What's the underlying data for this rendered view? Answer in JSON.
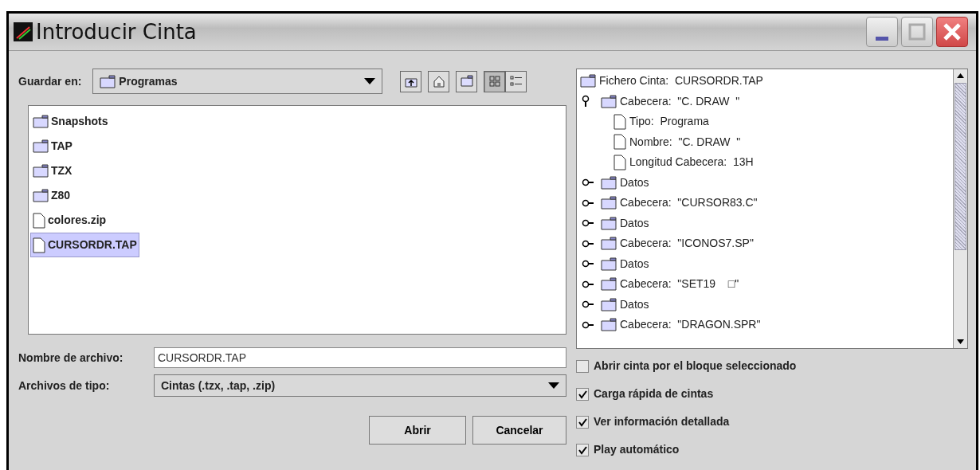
{
  "window": {
    "title": "Introducir Cinta"
  },
  "save_in": {
    "label": "Guardar en:",
    "value": "Programas"
  },
  "toolbar": [
    {
      "kind": "up-folder",
      "selected": false
    },
    {
      "kind": "home",
      "selected": false
    },
    {
      "kind": "new-folder",
      "selected": false
    },
    {
      "kind": "list-view",
      "selected": true
    },
    {
      "kind": "details-view",
      "selected": false
    }
  ],
  "files": [
    {
      "name": "Snapshots",
      "kind": "folder",
      "selected": false
    },
    {
      "name": "TAP",
      "kind": "folder",
      "selected": false
    },
    {
      "name": "TZX",
      "kind": "folder",
      "selected": false
    },
    {
      "name": "Z80",
      "kind": "folder",
      "selected": false
    },
    {
      "name": "colores.zip",
      "kind": "file",
      "selected": false
    },
    {
      "name": "CURSORDR.TAP",
      "kind": "file",
      "selected": true
    }
  ],
  "file_name": {
    "label": "Nombre de archivo:",
    "value": "CURSORDR.TAP"
  },
  "file_type": {
    "label": "Archivos de tipo:",
    "value": "Cintas (.tzx, .tap, .zip)"
  },
  "buttons": [
    {
      "label": "Abrir"
    },
    {
      "label": "Cancelar"
    }
  ],
  "tree": {
    "label": "Fichero Cinta:  CURSORDR.TAP",
    "kind": "folder",
    "children": [
      {
        "label": "Cabecera:  \"C. DRAW  \"",
        "kind": "folder",
        "expanded": true,
        "children": [
          {
            "label": "Tipo:  Programa",
            "kind": "file"
          },
          {
            "label": "Nombre:  \"C. DRAW  \"",
            "kind": "file"
          },
          {
            "label": "Longitud Cabecera:  13H",
            "kind": "file"
          }
        ]
      },
      {
        "label": "Datos",
        "kind": "folder",
        "expanded": false
      },
      {
        "label": "Cabecera:  \"CURSOR83.C\"",
        "kind": "folder",
        "expanded": false
      },
      {
        "label": "Datos",
        "kind": "folder",
        "expanded": false
      },
      {
        "label": "Cabecera:  \"ICONOS7.SP\"",
        "kind": "folder",
        "expanded": false
      },
      {
        "label": "Datos",
        "kind": "folder",
        "expanded": false
      },
      {
        "label": "Cabecera:  \"SET19    □\"",
        "kind": "folder",
        "expanded": false
      },
      {
        "label": "Datos",
        "kind": "folder",
        "expanded": false
      },
      {
        "label": "Cabecera:  \"DRAGON.SPR\"",
        "kind": "folder",
        "expanded": false
      }
    ]
  },
  "options": [
    {
      "label": "Abrir cinta por el bloque seleccionado",
      "checked": false
    },
    {
      "label": "Carga rápida de cintas",
      "checked": true
    },
    {
      "label": "Ver información detallada",
      "checked": true
    },
    {
      "label": "Play automático",
      "checked": true
    }
  ]
}
